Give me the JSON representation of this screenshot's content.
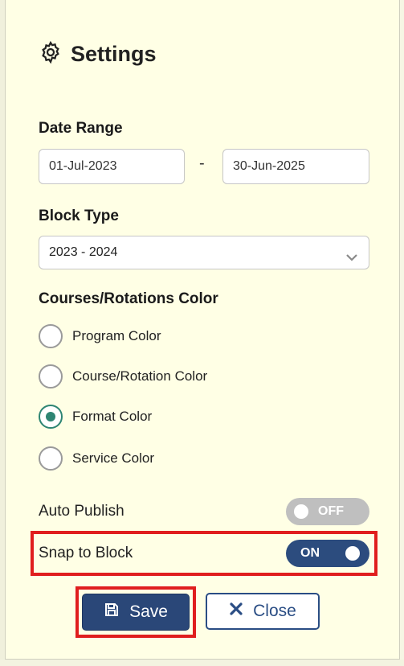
{
  "title": "Settings",
  "date_range": {
    "label": "Date Range",
    "start": "01-Jul-2023",
    "separator": "-",
    "end": "30-Jun-2025"
  },
  "block_type": {
    "label": "Block Type",
    "selected": "2023 - 2024"
  },
  "color": {
    "label": "Courses/Rotations Color",
    "options": [
      {
        "label": "Program Color",
        "checked": false
      },
      {
        "label": "Course/Rotation Color",
        "checked": false
      },
      {
        "label": "Format Color",
        "checked": true
      },
      {
        "label": "Service Color",
        "checked": false
      }
    ]
  },
  "auto_publish": {
    "label": "Auto Publish",
    "state": "OFF"
  },
  "snap_to_block": {
    "label": "Snap to Block",
    "state": "ON"
  },
  "buttons": {
    "save": "Save",
    "close": "Close"
  },
  "colors": {
    "panel_bg": "#ffffe5",
    "accent_dark_blue": "#2a4778",
    "radio_green": "#2e8573",
    "highlight_red": "#e01e1e",
    "toggle_off": "#bfbfbf"
  },
  "icons": {
    "title": "gear-icon",
    "save": "floppy-disk-icon",
    "close": "x-icon",
    "select": "chevron-down-icon"
  }
}
